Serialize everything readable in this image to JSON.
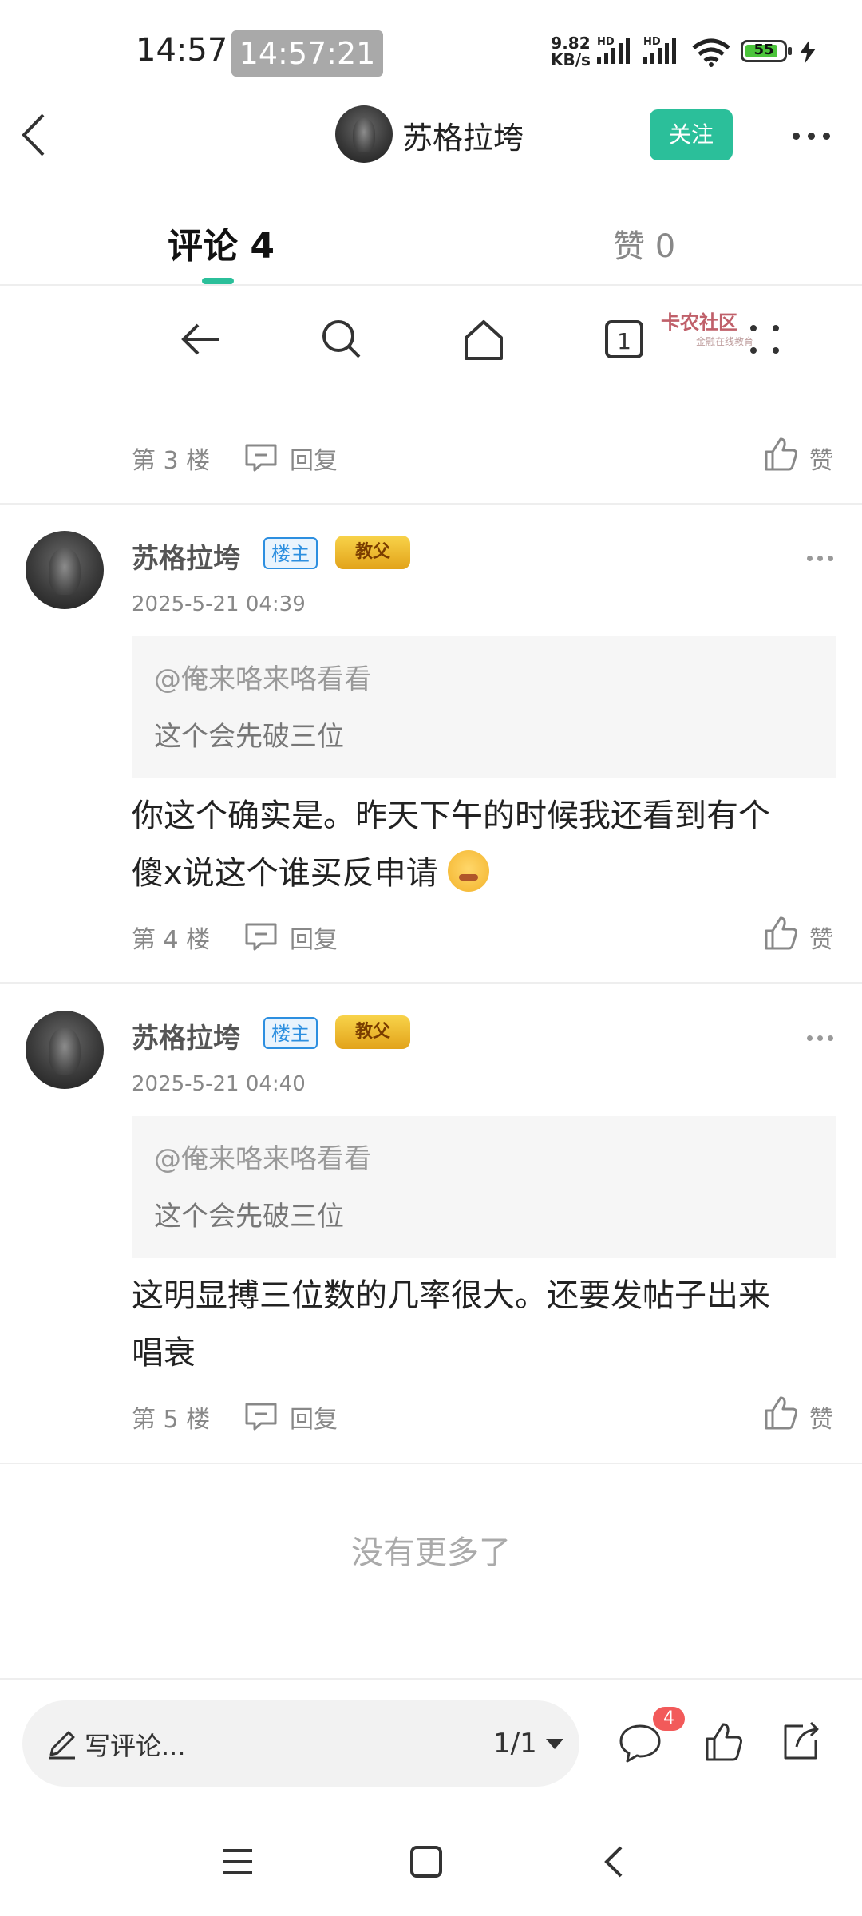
{
  "status_bar": {
    "time": "14:57",
    "time_overlay": "14:57:21",
    "net_speed_value": "9.82",
    "net_speed_unit": "KB/s",
    "hd1": "HD",
    "hd2": "HD",
    "battery": "55"
  },
  "header": {
    "title": "苏格拉垮",
    "follow_label": "关注"
  },
  "tabs": {
    "comments_label": "评论 4",
    "likes_label": "赞 0"
  },
  "watermark": {
    "title": "卡农社区",
    "subtitle": "金融在线教育"
  },
  "nav_bar": {
    "tab_count": "1"
  },
  "floors": [
    {
      "floor_label": "第 3 楼",
      "reply_label": "回复",
      "like_label": "赞"
    }
  ],
  "comments": [
    {
      "author": "苏格拉垮",
      "host_badge": "楼主",
      "rank_badge": "教父",
      "date": "2025-5-21 04:39",
      "quote_user": "@俺来咯来咯看看",
      "quote_text": "这个会先破三位",
      "body_line1": "你这个确实是。昨天下午的时候我还看到有个",
      "body_line2": "傻x说这个谁买反申请",
      "floor_label": "第 4 楼",
      "reply_label": "回复",
      "like_label": "赞"
    },
    {
      "author": "苏格拉垮",
      "host_badge": "楼主",
      "rank_badge": "教父",
      "date": "2025-5-21 04:40",
      "quote_user": "@俺来咯来咯看看",
      "quote_text": "这个会先破三位",
      "body_line1": "这明显搏三位数的几率很大。还要发帖子出来",
      "body_line2": "唱衰",
      "floor_label": "第 5 楼",
      "reply_label": "回复",
      "like_label": "赞"
    }
  ],
  "end_text": "没有更多了",
  "bottom_bar": {
    "placeholder": "写评论...",
    "page_indicator": "1/1",
    "comment_count": "4"
  },
  "colors": {
    "accent": "#2bbf9a",
    "host_badge": "#2d8fe0",
    "notification": "#f25a5a"
  }
}
